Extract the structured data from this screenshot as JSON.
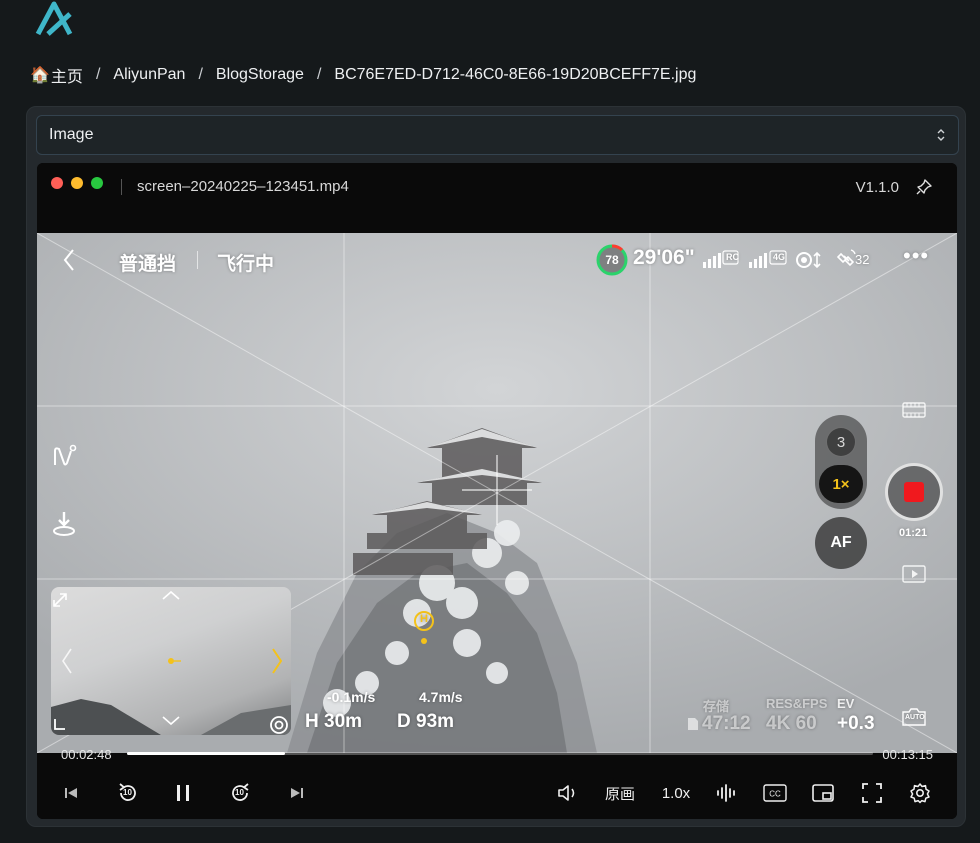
{
  "breadcrumb": {
    "home": "主页",
    "items": [
      "AliyunPan",
      "BlogStorage",
      "BC76E7ED-D712-46C0-8E66-19D20BCEFF7E.jpg"
    ]
  },
  "select": {
    "value": "Image"
  },
  "player": {
    "filename": "screen–20240225–123451.mp4",
    "version": "V1.1.0",
    "current_time": "00:02:48",
    "duration": "00:13:15",
    "progress_fraction": 0.212,
    "quality_label": "原画",
    "speed_label": "1.0x",
    "rewind_seconds": "10",
    "forward_seconds": "10"
  },
  "hud": {
    "mode": "普通挡",
    "status": "飞行中",
    "battery": "78",
    "flight_time_left": "29'06\"",
    "rc_label": "RC",
    "net_label": "4G",
    "satellites": "32",
    "more": "•••",
    "zoom_level_3": "3",
    "zoom_level_1": "1×",
    "af": "AF",
    "record_time": "01:21",
    "home_marker": "H",
    "vertical_speed": "-0.1m/s",
    "horizontal_speed": "4.7m/s",
    "altitude": "H 30m",
    "distance": "D 93m",
    "storage_label": "存储",
    "storage_value": "47:12",
    "res_label": "RES&FPS",
    "res_value": "4K 60",
    "ev_label": "EV",
    "ev_value": "+0.3",
    "auto_label": "AUTO"
  },
  "colors": {
    "background": "#15191b",
    "accent_logo": "#3fb6c9",
    "record_red": "#f0191e",
    "zoom_yellow": "#f4c21a",
    "battery_green": "#2bd36b"
  }
}
